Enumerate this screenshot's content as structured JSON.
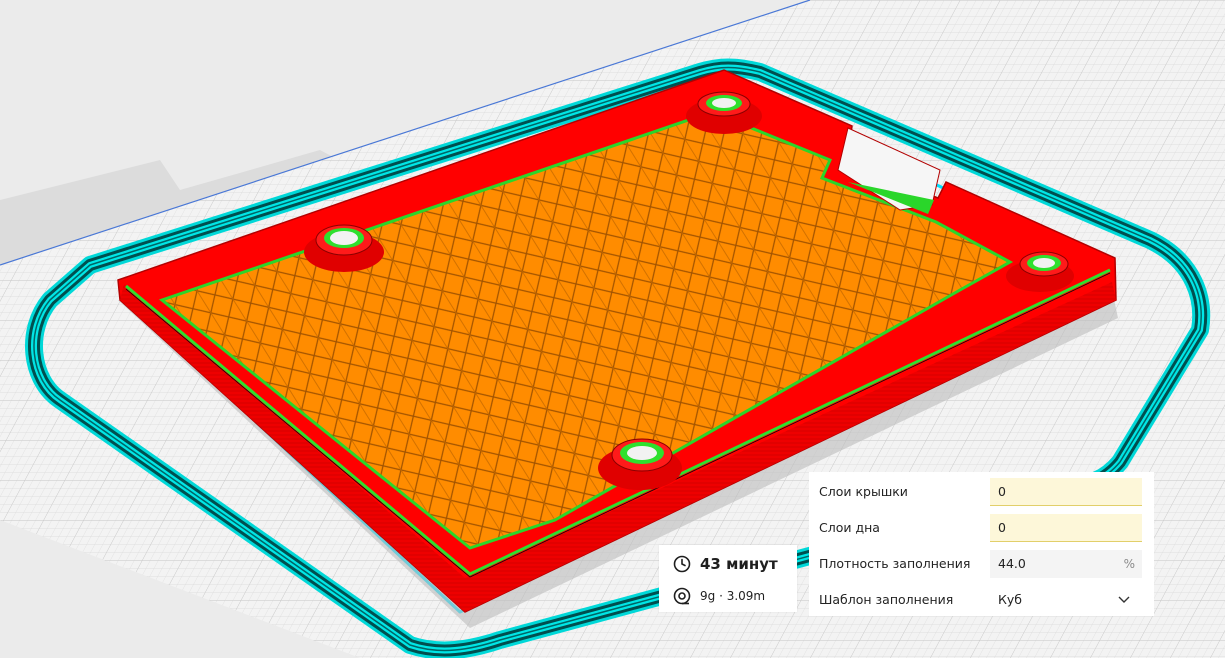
{
  "print_info": {
    "time_text": "43 минут",
    "material_text": "9g · 3.09m",
    "icons": {
      "time": "clock-icon",
      "material": "filament-spool-icon"
    }
  },
  "settings": {
    "top_layers": {
      "label": "Слои крышки",
      "value": "0"
    },
    "bottom_layers": {
      "label": "Слои дна",
      "value": "0"
    },
    "infill_density": {
      "label": "Плотность заполнения",
      "value": "44.0",
      "unit": "%"
    },
    "infill_pattern": {
      "label": "Шаблон заполнения",
      "value": "Куб",
      "icon": "chevron-down-icon"
    }
  },
  "colors": {
    "wall": "#ff0000",
    "infill": "#ff8c00",
    "support_skin": "#33d633",
    "skirt": "#00e0e0",
    "build_plate": "#f4f4f4",
    "field_warning": "#fdf7d9"
  }
}
